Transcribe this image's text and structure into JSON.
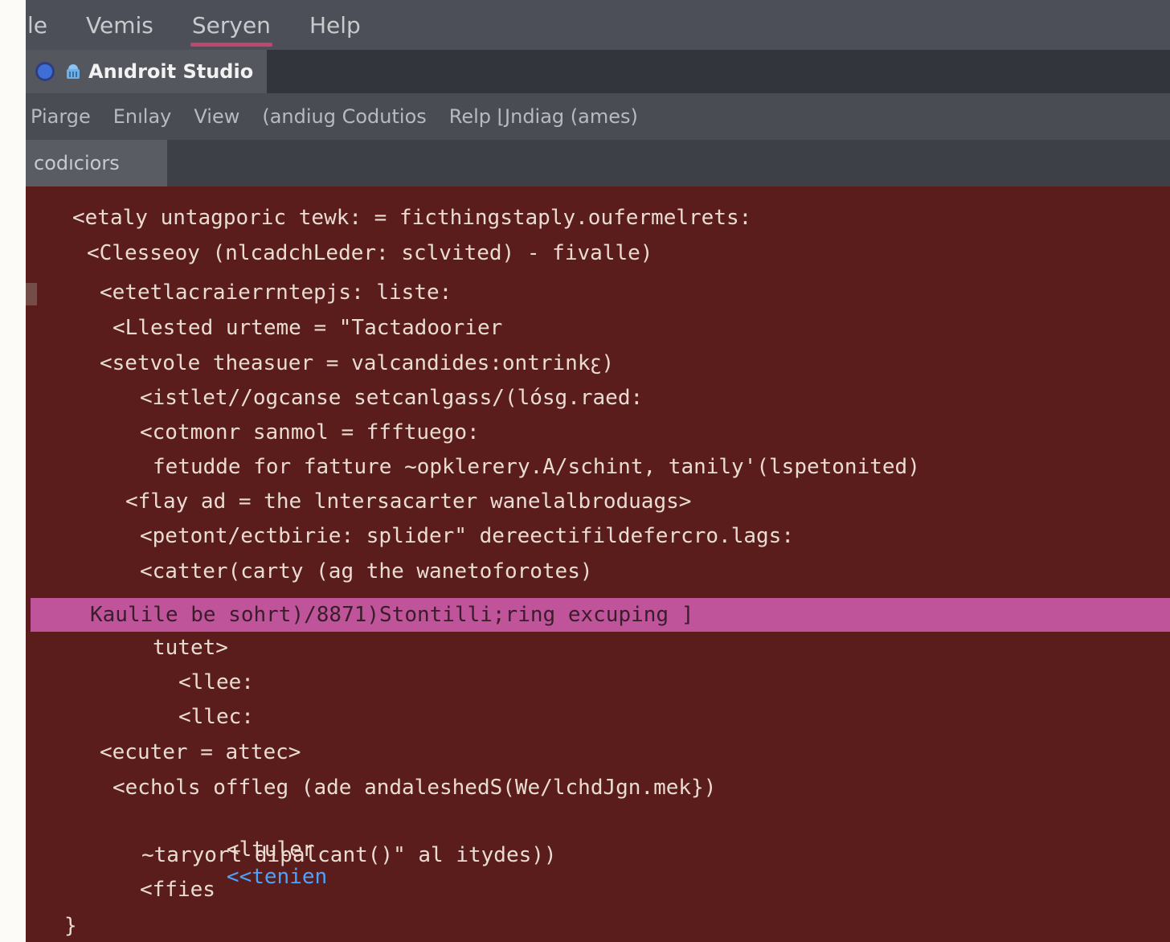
{
  "os_menu": {
    "items": [
      {
        "label": "le",
        "active": false
      },
      {
        "label": "Vemis",
        "active": false
      },
      {
        "label": "Seryen",
        "active": true
      },
      {
        "label": "Help",
        "active": false
      }
    ]
  },
  "window": {
    "title": "Anıdroit Studio"
  },
  "ide_menu": {
    "items": [
      "Piarge",
      "Enılay",
      "View",
      "(andiug Codutios",
      "Relp ⌊Jndiag (ames)"
    ]
  },
  "tool_tab": {
    "label": "codıciors"
  },
  "editor": {
    "lines": [
      "<etaly untagporic tewk: = ficthingstaply.oufermelrets:",
      "<Clesseoy (nlcadchLeder: sclvited) - fivalle)",
      "<etetlacraierrntepjs: liste:",
      "<Llested urteme = \"Tactadoorier",
      "<setvole theasuer = valcandides:ontrinkꜫ)",
      "<istlet//ogcanse setcanlgass/(lósg.raed:",
      "<cotmonr sanmol = ffftuego:",
      "fetudde for fatture ~opklerery.A/schint, tanily'(lspetonited)",
      "<flay ad = the lntersacarter wanelalbroduags>",
      "<petont/ectbirie: splider\" dereectifildefercro.lags:",
      "<catter(carty (ag the wanetoforotes)",
      "Kaulile be sohrt)/8871)Stontilli;ring excuping ]",
      "tutet>",
      "<llee:",
      "<llec:",
      "<ecuter = attec>",
      "<echols offleg (ade andaleshedS(We/lchdJgn.mek})",
      "<ltuler",
      "<<tenien",
      "~taryort dipalcant()\" al itydes))",
      "<ffies",
      "}"
    ]
  },
  "colors": {
    "editor_bg": "#5a1d1b",
    "highlight": "#c0549a",
    "active_tab_underline": "#c0466e"
  }
}
